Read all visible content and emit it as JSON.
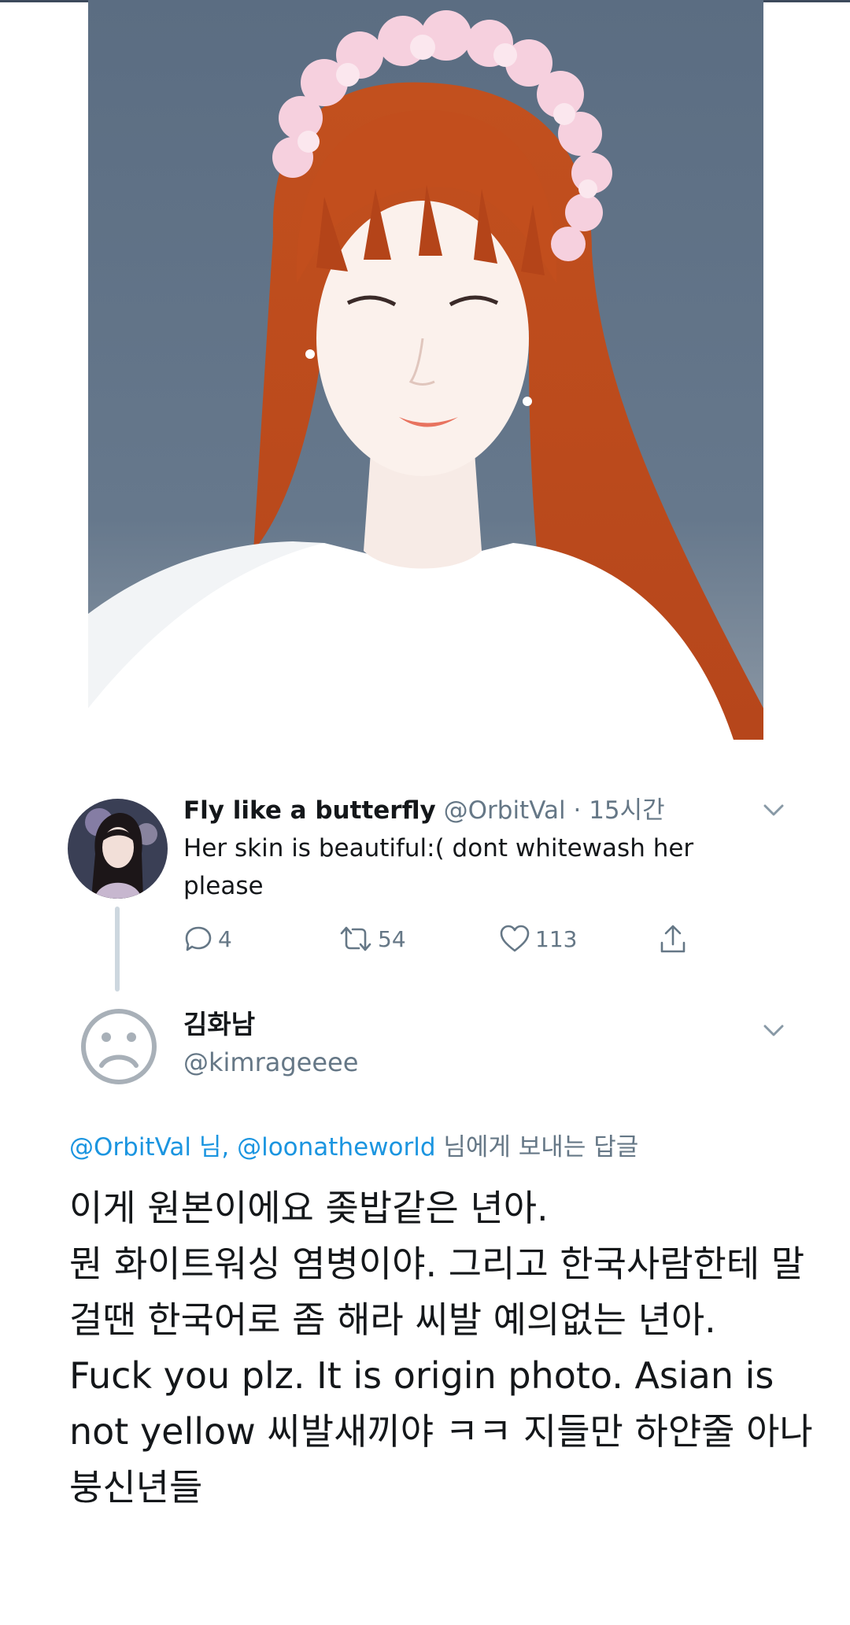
{
  "tweet": {
    "author_name": "Fly like a butterfly",
    "author_handle": "@OrbitVal",
    "separator": " · ",
    "time": "15시간",
    "text": "Her skin is beautiful:( dont whitewash her please",
    "actions": {
      "reply_count": "4",
      "retweet_count": "54",
      "like_count": "113"
    }
  },
  "reply": {
    "author_name": "김화남",
    "author_handle": "@kimrageeee",
    "reply_to_handle_1": "@OrbitVal",
    "reply_to_suffix_1": " 님, ",
    "reply_to_handle_2": "@loonatheworld",
    "reply_to_suffix_2": " 님에게 보내는 답글",
    "lines": [
      "이게 원본이에요 좆밥같은 년아.",
      "뭔 화이트워싱 염병이야. 그리고 한국사람한테 말걸땐 한국어로 좀 해라 씨발 예의없는 년아.",
      "Fuck you plz. It is origin photo. Asian is not yellow  씨발새끼야 ㅋㅋ 지들만 하얀줄 아나 붕신년들"
    ]
  },
  "icons": {
    "reply": "speech-bubble-icon",
    "retweet": "retweet-icon",
    "like": "heart-icon",
    "share": "share-icon",
    "more": "chevron-down-icon",
    "default_avatar": "sad-face-icon"
  },
  "colors": {
    "link": "#1b95e0",
    "secondary_text": "#657786",
    "primary_text": "#14171a",
    "thread_line": "#cdd7df"
  }
}
